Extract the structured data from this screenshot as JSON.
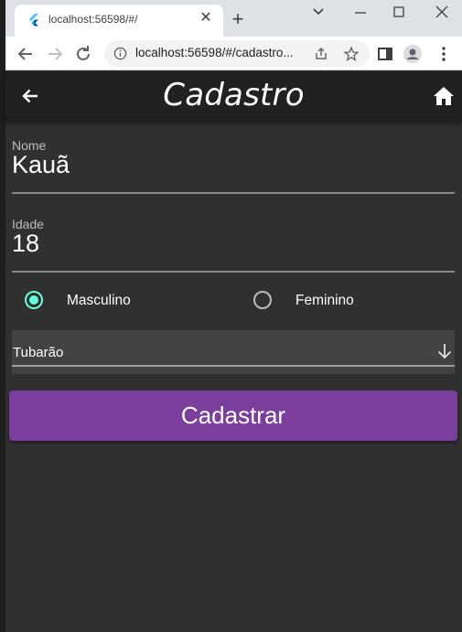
{
  "browser": {
    "tab_title": "localhost:56598/#/",
    "url": "localhost:56598/#/cadastro...",
    "icons": {
      "tab_close": "close-icon",
      "new_tab": "plus-icon",
      "minimize": "minimize-icon",
      "maximize": "maximize-icon",
      "close_window": "close-icon",
      "back": "arrow-left-icon",
      "forward": "arrow-right-icon",
      "reload": "reload-icon",
      "info": "info-icon",
      "share": "share-icon",
      "bookmark": "star-icon",
      "sidepanel": "sidepanel-icon",
      "profile": "profile-icon",
      "menu": "kebab-menu-icon"
    }
  },
  "app": {
    "title": "Cadastro",
    "back_icon": "arrow-back-icon",
    "home_icon": "home-icon",
    "fields": {
      "nome_label": "Nome",
      "nome_value": "Kauã",
      "idade_label": "Idade",
      "idade_value": "18"
    },
    "gender": {
      "options": [
        "Masculino",
        "Feminino"
      ],
      "selected": "Masculino"
    },
    "dropdown": {
      "value": "Tubarão",
      "icon": "arrow-downward-icon"
    },
    "submit_label": "Cadastrar",
    "colors": {
      "app_bg": "#303030",
      "appbar_bg": "#212121",
      "accent": "#64ffda",
      "button": "#7a3e9d"
    }
  }
}
